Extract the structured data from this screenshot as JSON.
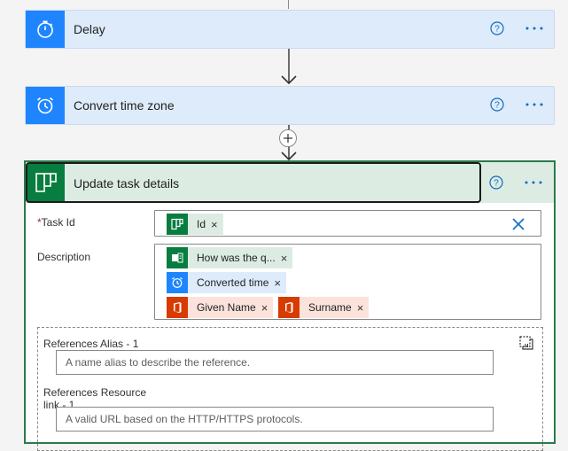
{
  "steps": [
    {
      "title": "Delay",
      "icon": "timer-icon"
    },
    {
      "title": "Convert time zone",
      "icon": "alarm-clock-icon"
    }
  ],
  "action": {
    "title": "Update task details",
    "icon": "planner-icon",
    "task_id": {
      "label": "Task Id",
      "required_marker": "*",
      "token": {
        "text": "Id",
        "icon": "planner-icon"
      }
    },
    "description": {
      "label": "Description",
      "tokens": [
        {
          "text": "How was the q...",
          "icon": "forms-icon"
        },
        {
          "text": "Converted time",
          "icon": "alarm-clock-icon"
        },
        {
          "text": "Given Name",
          "icon": "office-icon"
        },
        {
          "text": "Surname",
          "icon": "office-icon"
        }
      ]
    },
    "references": {
      "alias_label": "References Alias - 1",
      "alias_placeholder": "A name alias to describe the reference.",
      "resource_label_line1": "References Resource",
      "resource_label_line2": "link - 1",
      "resource_placeholder": "A valid URL based on the HTTP/HTTPS protocols."
    }
  },
  "colors": {
    "step_header": "#deebfb",
    "step_icon": "#1f85ff",
    "planner_header": "#dcece3",
    "planner_icon": "#077d3f",
    "office_icon": "#d83b01",
    "office_token": "#fbe3dc",
    "link_blue": "#0f6cbd"
  }
}
